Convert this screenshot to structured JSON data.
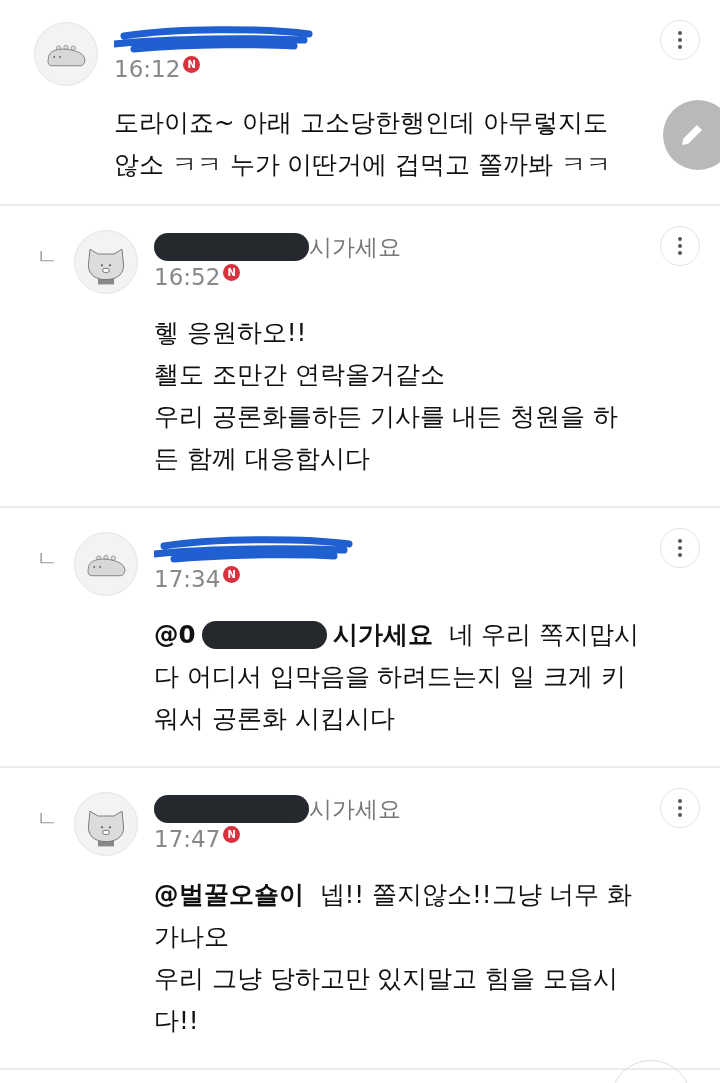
{
  "comments": [
    {
      "reply": false,
      "avatar": {
        "kind": "seal"
      },
      "author": {
        "kind": "scribble"
      },
      "time": "16:12",
      "badge": "N",
      "lines": [
        "도라이죠~ 아래 고소당한행인데 아무렇지도",
        "않소 ㅋㅋ 누가 이딴거에 겁먹고 쫄까봐 ㅋㅋ"
      ]
    },
    {
      "reply": true,
      "reply_mark": "ㄴ",
      "avatar": {
        "kind": "cat"
      },
      "author": {
        "kind": "bar",
        "visible_text": "시가세요"
      },
      "time": "16:52",
      "badge": "N",
      "lines": [
        "헿 응원하오!!",
        "쵈도 조만간 연락올거같소",
        "우리 공론화를하든 기사를 내든 청원을 하",
        "든 함께 대응합시다"
      ]
    },
    {
      "reply": true,
      "reply_mark": "ㄴ",
      "avatar": {
        "kind": "seal"
      },
      "author": {
        "kind": "scribble"
      },
      "time": "17:34",
      "badge": "N",
      "mention": {
        "start": "@0",
        "redacted": true,
        "end": "시가세요"
      },
      "first_line": "네 우리 쪽지맙시",
      "lines": [
        "다 어디서 입막음을 하려드는지 일 크게 키",
        "워서 공론화 시킵시다"
      ]
    },
    {
      "reply": true,
      "reply_mark": "ㄴ",
      "avatar": {
        "kind": "cat"
      },
      "author": {
        "kind": "bar",
        "visible_text": "시가세요"
      },
      "time": "17:47",
      "badge": "N",
      "mention": {
        "start": "@벌꿀오숄이"
      },
      "first_line": "넵!! 쫄지않소!!그냥 너무 화",
      "lines": [
        "가나오",
        "우리 그냥 당하고만 있지말고 힘을 모읍시",
        "다!!"
      ]
    }
  ]
}
